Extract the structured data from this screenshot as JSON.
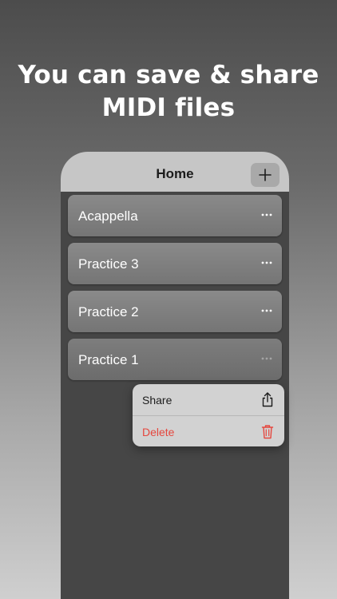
{
  "headline": {
    "line1": "You can save & share",
    "line2": "MIDI files"
  },
  "nav": {
    "title": "Home",
    "add_icon": "plus-icon"
  },
  "rows": [
    {
      "label": "Acappella",
      "more_icon": "ellipsis-icon"
    },
    {
      "label": "Practice 3",
      "more_icon": "ellipsis-icon"
    },
    {
      "label": "Practice 2",
      "more_icon": "ellipsis-icon"
    },
    {
      "label": "Practice 1",
      "more_icon": "ellipsis-icon"
    }
  ],
  "menu": {
    "items": [
      {
        "label": "Share",
        "icon": "share-icon",
        "color": "#1c1c1c"
      },
      {
        "label": "Delete",
        "icon": "trash-icon",
        "color": "#e5473e"
      }
    ]
  },
  "colors": {
    "phone_bg": "#464646",
    "nav_bg": "#c6c6c6",
    "row_bg": "#808080",
    "menu_bg": "#d2d2d2",
    "destructive": "#e5473e"
  }
}
